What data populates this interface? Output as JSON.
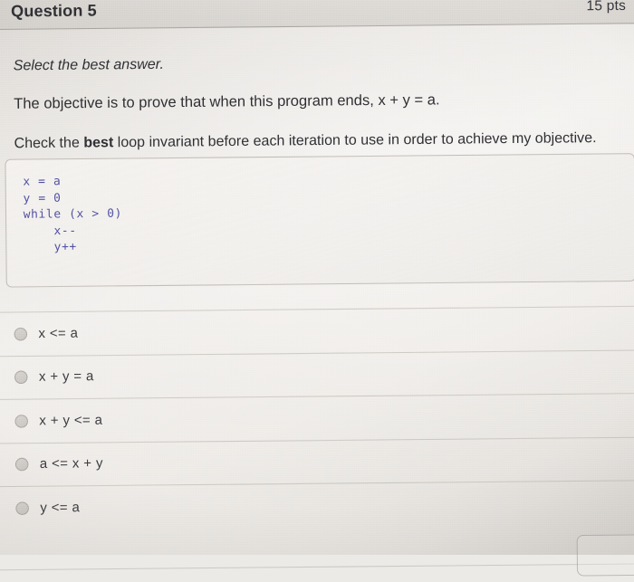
{
  "header": {
    "title": "Question 5",
    "points": "15 pts"
  },
  "prompt": {
    "instruction": "Select the best answer.",
    "objective": "The objective is to prove that when this program ends, x + y = a.",
    "check_prefix": "Check the ",
    "check_bold": "best",
    "check_suffix": " loop invariant before each iteration to use in order to achieve my objective."
  },
  "code": {
    "lines": [
      "x = a",
      "y = 0",
      "while (x > 0)",
      "    x--",
      "    y++"
    ],
    "text": "x = a\ny = 0\nwhile (x > 0)\n    x--\n    y++",
    "color": "#4f4fa0"
  },
  "options": [
    {
      "id": "opt-1",
      "label": "x <= a",
      "selected": false
    },
    {
      "id": "opt-2",
      "label": "x + y = a",
      "selected": false
    },
    {
      "id": "opt-3",
      "label": "x + y <= a",
      "selected": false
    },
    {
      "id": "opt-4",
      "label": "a <= x + y",
      "selected": false
    },
    {
      "id": "opt-5",
      "label": "y <= a",
      "selected": false
    }
  ],
  "colors": {
    "page_background": "#eceae7",
    "text": "#2e2e32",
    "option_text": "#3a3a3e",
    "code_text": "#4f4fa0",
    "divider": "#b2ada6"
  }
}
